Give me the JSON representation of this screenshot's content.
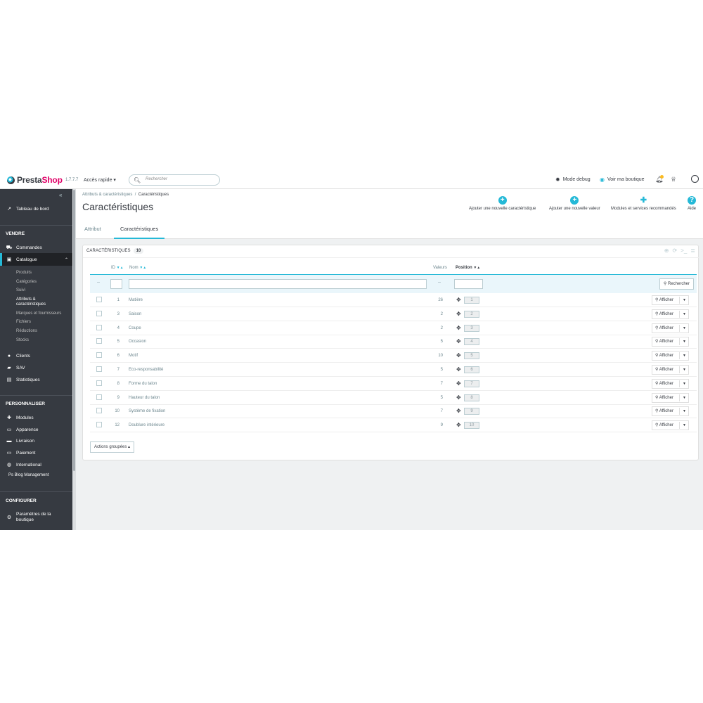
{
  "header": {
    "brand_a": "Presta",
    "brand_b": "Shop",
    "version": "1.7.7.7",
    "quick_access": "Accès rapide ▾",
    "search_placeholder": "Rechercher",
    "debug": "Mode debug",
    "view_shop": "Voir ma boutique"
  },
  "sidebar": {
    "dashboard": "Tableau de bord",
    "sell_section": "VENDRE",
    "orders": "Commandes",
    "catalog": "Catalogue",
    "catalog_sub": [
      "Produits",
      "Catégories",
      "Suivi",
      "Attributs &",
      "caractéristiques",
      "Marques et fournisseurs",
      "Fichiers",
      "Réductions",
      "Stocks"
    ],
    "clients": "Clients",
    "sav": "SAV",
    "stats": "Statistiques",
    "customize_section": "PERSONNALISER",
    "modules": "Modules",
    "appearance": "Apparence",
    "shipping": "Livraison",
    "payment": "Paiement",
    "international": "International",
    "blog": "Ps Blog Management",
    "configure_section": "CONFIGURER",
    "shop_params_1": "Paramètres de la",
    "shop_params_2": "boutique"
  },
  "page": {
    "breadcrumb_parent": "Attributs & caractéristiques",
    "breadcrumb_current": "Caractéristiques",
    "title": "Caractéristiques",
    "toolbar": [
      "Ajouter une nouvelle caractéristique",
      "Ajouter une nouvelle valeur",
      "Modules et services recommandés",
      "Aide"
    ],
    "tabs": [
      "Attribut",
      "Caractéristiques"
    ]
  },
  "table": {
    "panel_title": "CARACTÉRISTIQUES",
    "count": "10",
    "columns": {
      "id": "ID",
      "name": "Nom",
      "values": "Valeurs",
      "position": "Position"
    },
    "filter_dash": "--",
    "search_button": "Rechercher",
    "action_label": "Afficher",
    "bulk_actions": "Actions groupées ▴",
    "rows": [
      {
        "id": "1",
        "name": "Matière",
        "values": "26",
        "position": "1"
      },
      {
        "id": "3",
        "name": "Saison",
        "values": "2",
        "position": "2"
      },
      {
        "id": "4",
        "name": "Coupe",
        "values": "2",
        "position": "3"
      },
      {
        "id": "5",
        "name": "Occasion",
        "values": "5",
        "position": "4"
      },
      {
        "id": "6",
        "name": "Motif",
        "values": "10",
        "position": "5"
      },
      {
        "id": "7",
        "name": "Eco-responsabilité",
        "values": "5",
        "position": "6"
      },
      {
        "id": "8",
        "name": "Forme du talon",
        "values": "7",
        "position": "7"
      },
      {
        "id": "9",
        "name": "Hauteur du talon",
        "values": "5",
        "position": "8"
      },
      {
        "id": "10",
        "name": "Système de fixation",
        "values": "7",
        "position": "9"
      },
      {
        "id": "12",
        "name": "Doublure intérieure",
        "values": "9",
        "position": "10"
      }
    ]
  },
  "colors": {
    "accent": "#25b9d7",
    "sidebar": "#363a41",
    "brand_pink": "#df0067"
  }
}
